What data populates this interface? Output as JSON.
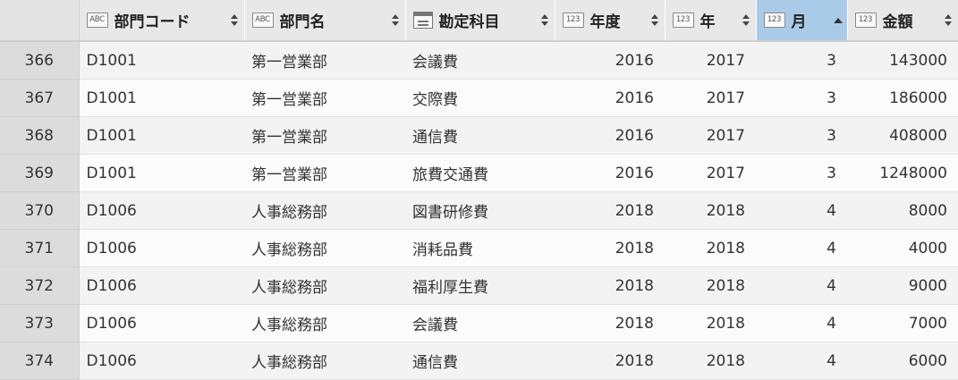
{
  "columns": [
    {
      "key": "code",
      "label": "部門コード",
      "type": "ABC",
      "sort": "none"
    },
    {
      "key": "name",
      "label": "部門名",
      "type": "ABC",
      "sort": "none"
    },
    {
      "key": "account",
      "label": "勘定科目",
      "type": "table",
      "sort": "none"
    },
    {
      "key": "fiscal_year",
      "label": "年度",
      "type": "123",
      "sort": "none"
    },
    {
      "key": "year",
      "label": "年",
      "type": "123",
      "sort": "none"
    },
    {
      "key": "month",
      "label": "月",
      "type": "123",
      "sort": "ascending"
    },
    {
      "key": "amount",
      "label": "金額",
      "type": "123",
      "sort": "none"
    }
  ],
  "accent_color": "#a9cbe8",
  "rows": [
    {
      "index": "366",
      "code": "D1001",
      "name": "第一営業部",
      "account": "会議費",
      "fiscal_year": "2016",
      "year": "2017",
      "month": "3",
      "amount": "143000"
    },
    {
      "index": "367",
      "code": "D1001",
      "name": "第一営業部",
      "account": "交際費",
      "fiscal_year": "2016",
      "year": "2017",
      "month": "3",
      "amount": "186000"
    },
    {
      "index": "368",
      "code": "D1001",
      "name": "第一営業部",
      "account": "通信費",
      "fiscal_year": "2016",
      "year": "2017",
      "month": "3",
      "amount": "408000"
    },
    {
      "index": "369",
      "code": "D1001",
      "name": "第一営業部",
      "account": "旅費交通費",
      "fiscal_year": "2016",
      "year": "2017",
      "month": "3",
      "amount": "1248000"
    },
    {
      "index": "370",
      "code": "D1006",
      "name": "人事総務部",
      "account": "図書研修費",
      "fiscal_year": "2018",
      "year": "2018",
      "month": "4",
      "amount": "8000"
    },
    {
      "index": "371",
      "code": "D1006",
      "name": "人事総務部",
      "account": "消耗品費",
      "fiscal_year": "2018",
      "year": "2018",
      "month": "4",
      "amount": "4000"
    },
    {
      "index": "372",
      "code": "D1006",
      "name": "人事総務部",
      "account": "福利厚生費",
      "fiscal_year": "2018",
      "year": "2018",
      "month": "4",
      "amount": "9000"
    },
    {
      "index": "373",
      "code": "D1006",
      "name": "人事総務部",
      "account": "会議費",
      "fiscal_year": "2018",
      "year": "2018",
      "month": "4",
      "amount": "7000"
    },
    {
      "index": "374",
      "code": "D1006",
      "name": "人事総務部",
      "account": "通信費",
      "fiscal_year": "2018",
      "year": "2018",
      "month": "4",
      "amount": "6000"
    }
  ]
}
